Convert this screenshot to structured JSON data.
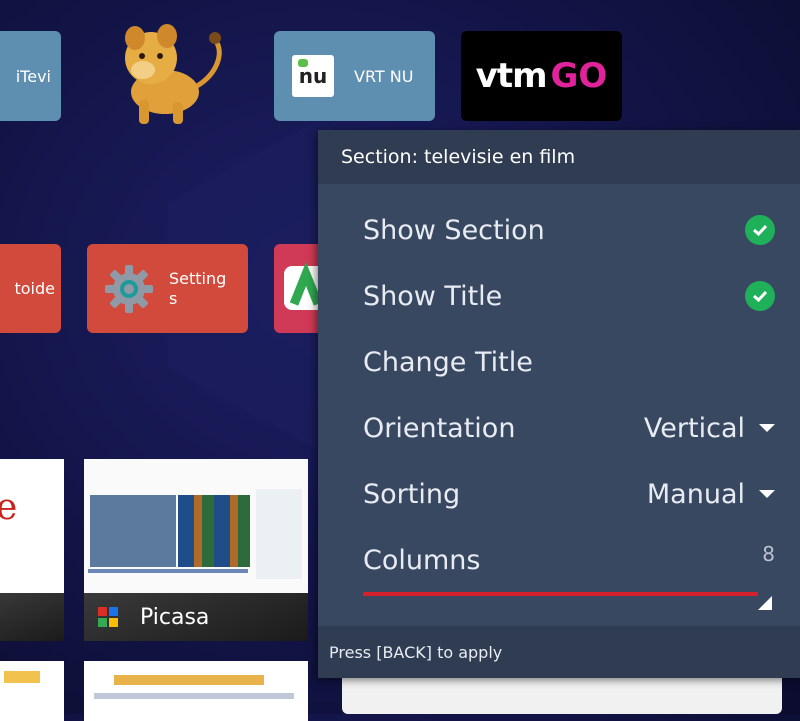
{
  "tiles": {
    "mitevi": {
      "label": "iTevi"
    },
    "vrt": {
      "label": "VRT NU",
      "logo_text": "nu"
    },
    "vtm": {
      "logo_main": "vtm",
      "logo_go": "GO"
    },
    "aptoide": {
      "label": "toide"
    },
    "settings": {
      "label": "Setting\ns"
    }
  },
  "thumbs": {
    "google_letter": "e",
    "picasa": {
      "label": "Picasa"
    }
  },
  "panel": {
    "header": "Section: televisie en film",
    "rows": [
      {
        "label": "Show Section",
        "checked": true
      },
      {
        "label": "Show Title",
        "checked": true
      },
      {
        "label": "Change Title"
      },
      {
        "label": "Orientation",
        "value": "Vertical"
      },
      {
        "label": "Sorting",
        "value": "Manual"
      },
      {
        "label": "Columns",
        "value": "8"
      }
    ],
    "slider_fraction": 1.0,
    "footer": "Press [BACK] to apply"
  },
  "colors": {
    "panel": "#384861",
    "panel_header": "#2f3c52",
    "check_green": "#1fb15a",
    "slider_red": "#d3202a",
    "tile_blue": "#5e8fb1",
    "tile_red": "#d24a3c"
  }
}
